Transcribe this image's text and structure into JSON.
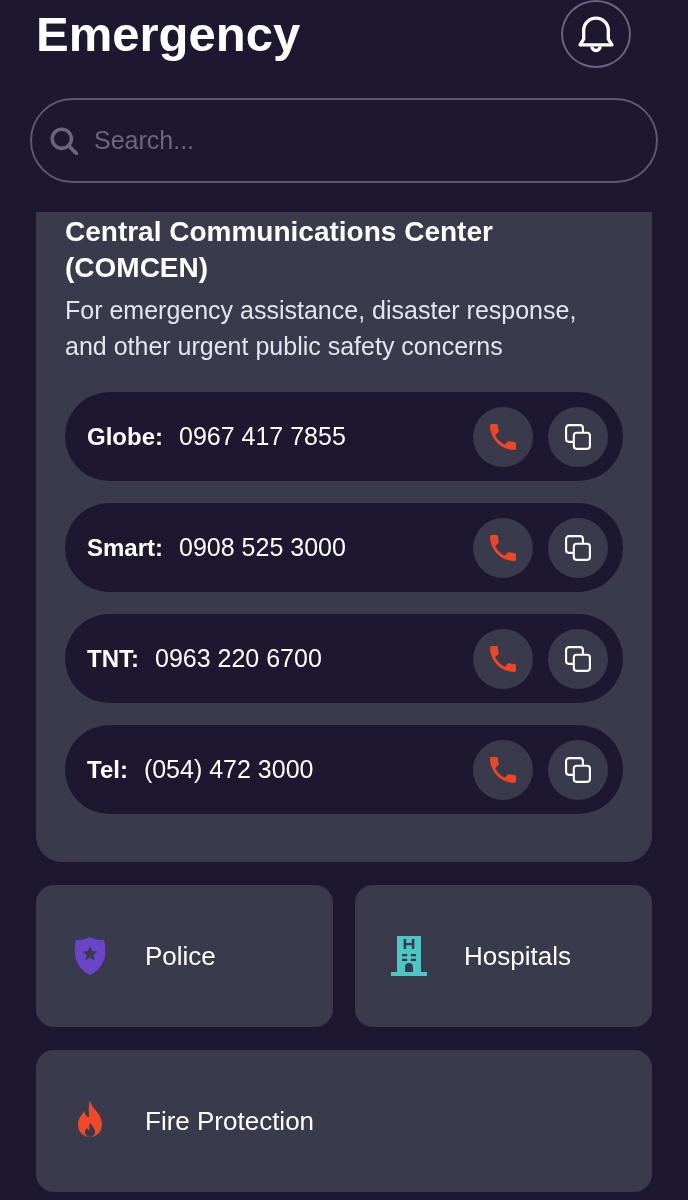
{
  "header": {
    "title": "Emergency"
  },
  "search": {
    "placeholder": "Search..."
  },
  "hotline": {
    "title": "Central Communications Center (COMCEN)",
    "description": "For emergency assistance, disaster response, and other urgent public safety concerns",
    "numbers": [
      {
        "label": "Globe:",
        "number": "0967 417 7855"
      },
      {
        "label": "Smart:",
        "number": "0908 525 3000"
      },
      {
        "label": "TNT:",
        "number": "0963 220 6700"
      },
      {
        "label": "Tel:",
        "number": "(054) 472 3000"
      }
    ]
  },
  "categories": [
    {
      "kind": "police",
      "label": "Police"
    },
    {
      "kind": "hospital",
      "label": "Hospitals"
    },
    {
      "kind": "fire",
      "label": "Fire Protection"
    }
  ]
}
